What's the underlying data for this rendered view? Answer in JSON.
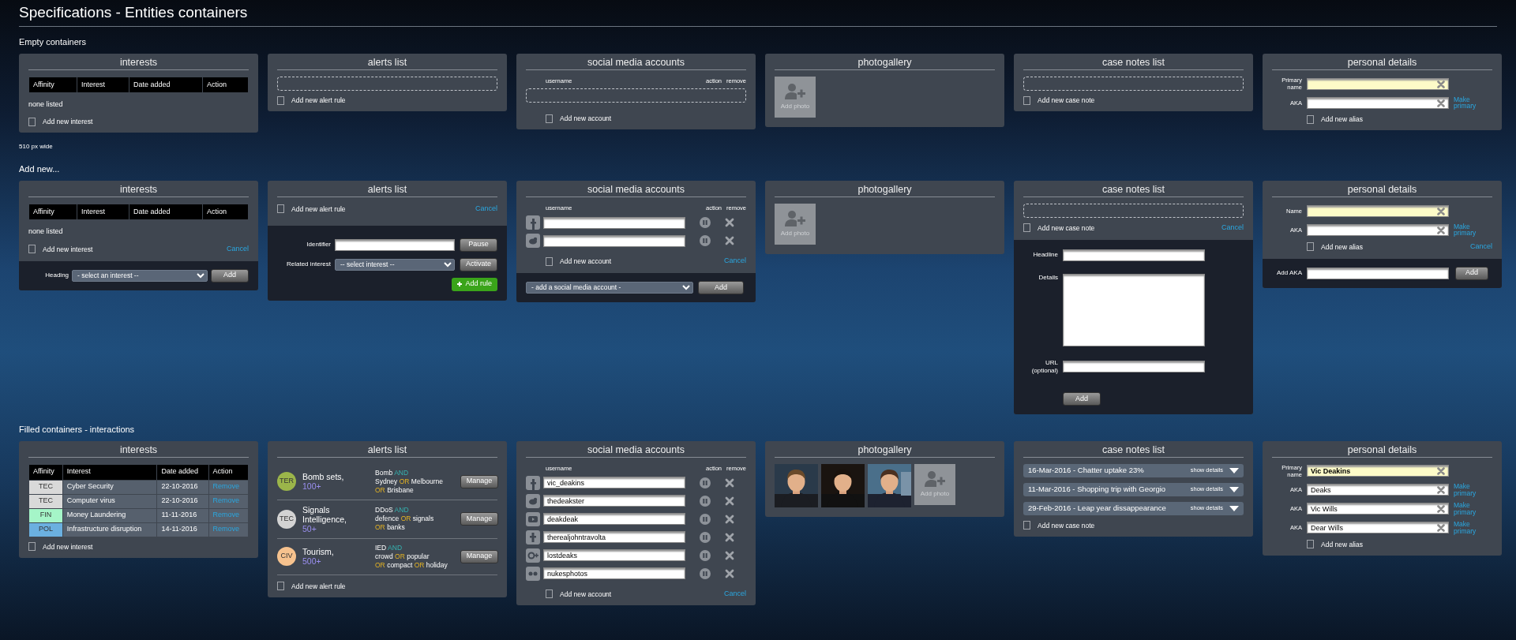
{
  "page_title": "Specifications - Entities containers",
  "sections": [
    {
      "title": "Empty containers",
      "containers": [
        {
          "kind": "interests",
          "title": "interests",
          "columns": [
            "Affinity",
            "Interest",
            "Date added",
            "Action"
          ],
          "empty_text": "none listed",
          "add_label": "Add new interest",
          "caption": "510 px wide"
        },
        {
          "kind": "alerts",
          "title": "alerts list",
          "drop_zone": true,
          "add_label": "Add new alert rule"
        },
        {
          "kind": "social",
          "title": "social media accounts",
          "columns": [
            "username",
            "action",
            "remove"
          ],
          "drop_zone": true,
          "add_label": "Add new account"
        },
        {
          "kind": "photos",
          "title": "photogallery",
          "add_label": "Add photo"
        },
        {
          "kind": "notes",
          "title": "case notes list",
          "drop_zone": true,
          "add_label": "Add new case note"
        },
        {
          "kind": "personal",
          "title": "personal details",
          "fields": [
            {
              "label": "Primary name",
              "primary": true
            },
            {
              "label": "AKA",
              "primary": false,
              "action": "Make primary"
            }
          ],
          "add_label": "Add new alias"
        }
      ]
    },
    {
      "title": "Add new...",
      "containers": [
        {
          "kind": "interests",
          "title": "interests",
          "columns": [
            "Affinity",
            "Interest",
            "Date added",
            "Action"
          ],
          "empty_text": "none listed",
          "add_label": "Add new interest",
          "cancel": "Cancel",
          "form": {
            "label": "Heading",
            "select": "- select an interest --",
            "button": "Add"
          }
        },
        {
          "kind": "alerts",
          "title": "alerts list",
          "add_label": "Add new alert rule",
          "cancel": "Cancel",
          "form": {
            "fields": [
              {
                "label": "Identifier",
                "kind": "input",
                "button": "Pause"
              },
              {
                "label": "Related interest",
                "kind": "select",
                "value": "-- select interest --",
                "button": "Activate"
              }
            ],
            "submit": "Add rule"
          }
        },
        {
          "kind": "social",
          "title": "social media accounts",
          "columns": [
            "username",
            "action",
            "remove"
          ],
          "accounts": [
            {
              "kind": "facebook"
            },
            {
              "kind": "twitter"
            }
          ],
          "add_label": "Add new account",
          "cancel": "Cancel",
          "form": {
            "select": "- add a social media account -",
            "button": "Add"
          }
        },
        {
          "kind": "photos",
          "title": "photogallery",
          "add_label": "Add photo"
        },
        {
          "kind": "notes",
          "title": "case notes list",
          "drop_zone": true,
          "add_label": "Add new case note",
          "cancel": "Cancel",
          "form": {
            "fields": [
              {
                "label": "Headline",
                "kind": "input"
              },
              {
                "label": "Details",
                "kind": "textarea"
              },
              {
                "label": "URL (optional)",
                "kind": "input"
              }
            ],
            "button": "Add"
          }
        },
        {
          "kind": "personal",
          "title": "personal details",
          "fields": [
            {
              "label": "Name",
              "primary": true
            },
            {
              "label": "AKA",
              "primary": false,
              "action": "Make primary"
            }
          ],
          "add_label": "Add new alias",
          "cancel": "Cancel",
          "form": {
            "label": "Add AKA",
            "button": "Add"
          }
        }
      ]
    },
    {
      "title": "Filled containers - interactions",
      "containers": [
        {
          "kind": "interests",
          "title": "interests",
          "columns": [
            "Affinity",
            "Interest",
            "Date added",
            "Action"
          ],
          "rows": [
            {
              "affinity": "TEC",
              "color": "#d9d9d9",
              "interest": "Cyber Security",
              "date": "22-10-2016",
              "action": "Remove"
            },
            {
              "affinity": "TEC",
              "color": "#d9d9d9",
              "interest": "Computer virus",
              "date": "22-10-2016",
              "action": "Remove"
            },
            {
              "affinity": "FIN",
              "color": "#a5f5c8",
              "interest": "Money Laundering",
              "date": "11-11-2016",
              "action": "Remove"
            },
            {
              "affinity": "POL",
              "color": "#6bb0e0",
              "interest": "Infrastructure disruption",
              "date": "14-11-2016",
              "action": "Remove"
            }
          ],
          "add_label": "Add new interest"
        },
        {
          "kind": "alerts",
          "title": "alerts list",
          "rules": [
            {
              "code": "TER",
              "color": "#9bb54a",
              "name": "Bomb sets,",
              "count": "100+",
              "lines": [
                [
                  {
                    "kind": "term",
                    "text": "Bomb"
                  },
                  {
                    "kind": "and",
                    "text": "AND"
                  }
                ],
                [
                  {
                    "kind": "term",
                    "text": "Sydney"
                  },
                  {
                    "kind": "or",
                    "text": "OR"
                  },
                  {
                    "kind": "term",
                    "text": "Melbourne"
                  }
                ],
                [
                  {
                    "kind": "or",
                    "text": "OR"
                  },
                  {
                    "kind": "term",
                    "text": "Brisbane"
                  }
                ]
              ],
              "button": "Manage"
            },
            {
              "code": "TEC",
              "color": "#d3d3d3",
              "name": "Signals Intelligence,",
              "count": "50+",
              "lines": [
                [
                  {
                    "kind": "term",
                    "text": "DDoS"
                  },
                  {
                    "kind": "and",
                    "text": "AND"
                  }
                ],
                [
                  {
                    "kind": "term",
                    "text": "defence"
                  },
                  {
                    "kind": "or",
                    "text": "OR"
                  },
                  {
                    "kind": "term",
                    "text": "signals"
                  }
                ],
                [
                  {
                    "kind": "or",
                    "text": "OR"
                  },
                  {
                    "kind": "term",
                    "text": "banks"
                  }
                ]
              ],
              "button": "Manage"
            },
            {
              "code": "CIV",
              "color": "#f6c28e",
              "name": "Tourism,",
              "count": "500+",
              "lines": [
                [
                  {
                    "kind": "term",
                    "text": "IED"
                  },
                  {
                    "kind": "and",
                    "text": "AND"
                  }
                ],
                [
                  {
                    "kind": "term",
                    "text": "crowd"
                  },
                  {
                    "kind": "or",
                    "text": "OR"
                  },
                  {
                    "kind": "term",
                    "text": "popular"
                  }
                ],
                [
                  {
                    "kind": "or",
                    "text": "OR"
                  },
                  {
                    "kind": "term",
                    "text": "compact"
                  },
                  {
                    "kind": "or",
                    "text": "OR"
                  },
                  {
                    "kind": "term",
                    "text": "holiday"
                  }
                ]
              ],
              "button": "Manage"
            }
          ],
          "add_label": "Add new alert rule"
        },
        {
          "kind": "social",
          "title": "social media accounts",
          "columns": [
            "username",
            "action",
            "remove"
          ],
          "accounts": [
            {
              "kind": "facebook",
              "value": "vic_deakins"
            },
            {
              "kind": "twitter",
              "value": "thedeakster"
            },
            {
              "kind": "youtube",
              "value": "deakdeak"
            },
            {
              "kind": "tumblr",
              "value": "therealjohntravolta"
            },
            {
              "kind": "googleplus",
              "value": "lostdeaks"
            },
            {
              "kind": "flickr",
              "value": "nukesphotos"
            }
          ],
          "add_label": "Add new account",
          "cancel": "Cancel"
        },
        {
          "kind": "photos",
          "title": "photogallery",
          "add_label": "Add photo"
        },
        {
          "kind": "notes",
          "title": "case notes list",
          "notes": [
            {
              "text": "16-Mar-2016 - Chatter uptake 23%",
              "details": "show details"
            },
            {
              "text": "11-Mar-2016 - Shopping trip with Georgio",
              "details": "show details"
            },
            {
              "text": "29-Feb-2016 - Leap year dissappearance",
              "details": "show details"
            }
          ],
          "add_label": "Add new case note"
        },
        {
          "kind": "personal",
          "title": "personal details",
          "fields": [
            {
              "label": "Primary name",
              "value": "Vic Deakins",
              "primary": true
            },
            {
              "label": "AKA",
              "value": "Deaks",
              "primary": false,
              "action": "Make primary"
            },
            {
              "label": "AKA",
              "value": "Vic Wills",
              "primary": false,
              "action": "Make primary"
            },
            {
              "label": "AKA",
              "value": "Dear Wills",
              "primary": false,
              "action": "Make primary"
            }
          ],
          "add_label": "Add new alias"
        }
      ]
    }
  ]
}
